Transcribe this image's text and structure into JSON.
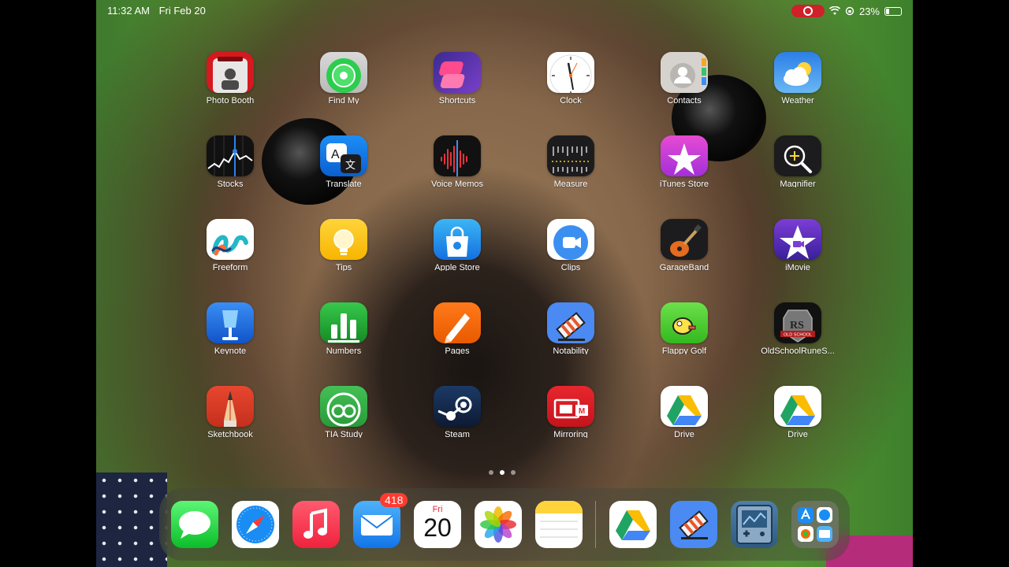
{
  "status": {
    "time": "11:32 AM",
    "date": "Fri Feb 20",
    "battery": "23%"
  },
  "apps": [
    {
      "label": "Photo Booth",
      "icon": "photo-booth-icon"
    },
    {
      "label": "Find My",
      "icon": "find-my-icon"
    },
    {
      "label": "Shortcuts",
      "icon": "shortcuts-icon"
    },
    {
      "label": "Clock",
      "icon": "clock-icon"
    },
    {
      "label": "Contacts",
      "icon": "contacts-icon"
    },
    {
      "label": "Weather",
      "icon": "weather-icon"
    },
    {
      "label": "Stocks",
      "icon": "stocks-icon"
    },
    {
      "label": "Translate",
      "icon": "translate-icon"
    },
    {
      "label": "Voice Memos",
      "icon": "voice-memos-icon"
    },
    {
      "label": "Measure",
      "icon": "measure-icon"
    },
    {
      "label": "iTunes Store",
      "icon": "itunes-store-icon"
    },
    {
      "label": "Magnifier",
      "icon": "magnifier-icon"
    },
    {
      "label": "Freeform",
      "icon": "freeform-icon"
    },
    {
      "label": "Tips",
      "icon": "tips-icon"
    },
    {
      "label": "Apple Store",
      "icon": "apple-store-icon"
    },
    {
      "label": "Clips",
      "icon": "clips-icon"
    },
    {
      "label": "GarageBand",
      "icon": "garageband-icon"
    },
    {
      "label": "iMovie",
      "icon": "imovie-icon"
    },
    {
      "label": "Keynote",
      "icon": "keynote-icon"
    },
    {
      "label": "Numbers",
      "icon": "numbers-icon"
    },
    {
      "label": "Pages",
      "icon": "pages-icon"
    },
    {
      "label": "Notability",
      "icon": "notability-icon"
    },
    {
      "label": "Flappy Golf",
      "icon": "flappy-golf-icon"
    },
    {
      "label": "OldSchoolRuneS...",
      "icon": "old-school-runescape-icon"
    },
    {
      "label": "Sketchbook",
      "icon": "sketchbook-icon"
    },
    {
      "label": "TIA Study",
      "icon": "tia-study-icon"
    },
    {
      "label": "Steam",
      "icon": "steam-icon"
    },
    {
      "label": "Mirroring",
      "icon": "mirroring-icon"
    },
    {
      "label": "Drive",
      "icon": "drive-icon"
    },
    {
      "label": "Drive",
      "icon": "drive-icon"
    }
  ],
  "icon_text": {
    "translate_a": "A",
    "translate_b": "文",
    "runescape_top": "RS",
    "runescape_bottom": "OLD SCHOOL",
    "mirroring_m": "M"
  },
  "page_dots": {
    "count": 3,
    "active": 1
  },
  "dock": {
    "mail_badge": "418",
    "calendar_day": "Fri",
    "calendar_date": "20",
    "items": [
      "messages-icon",
      "safari-icon",
      "music-icon",
      "mail-icon",
      "calendar-icon",
      "photos-icon",
      "notes-icon",
      "drive-icon",
      "notability-icon",
      "gameboy-emulator-icon",
      "app-library-icon"
    ]
  },
  "colors": {
    "record_indicator": "#d0202a",
    "badge": "#ff3b30"
  }
}
